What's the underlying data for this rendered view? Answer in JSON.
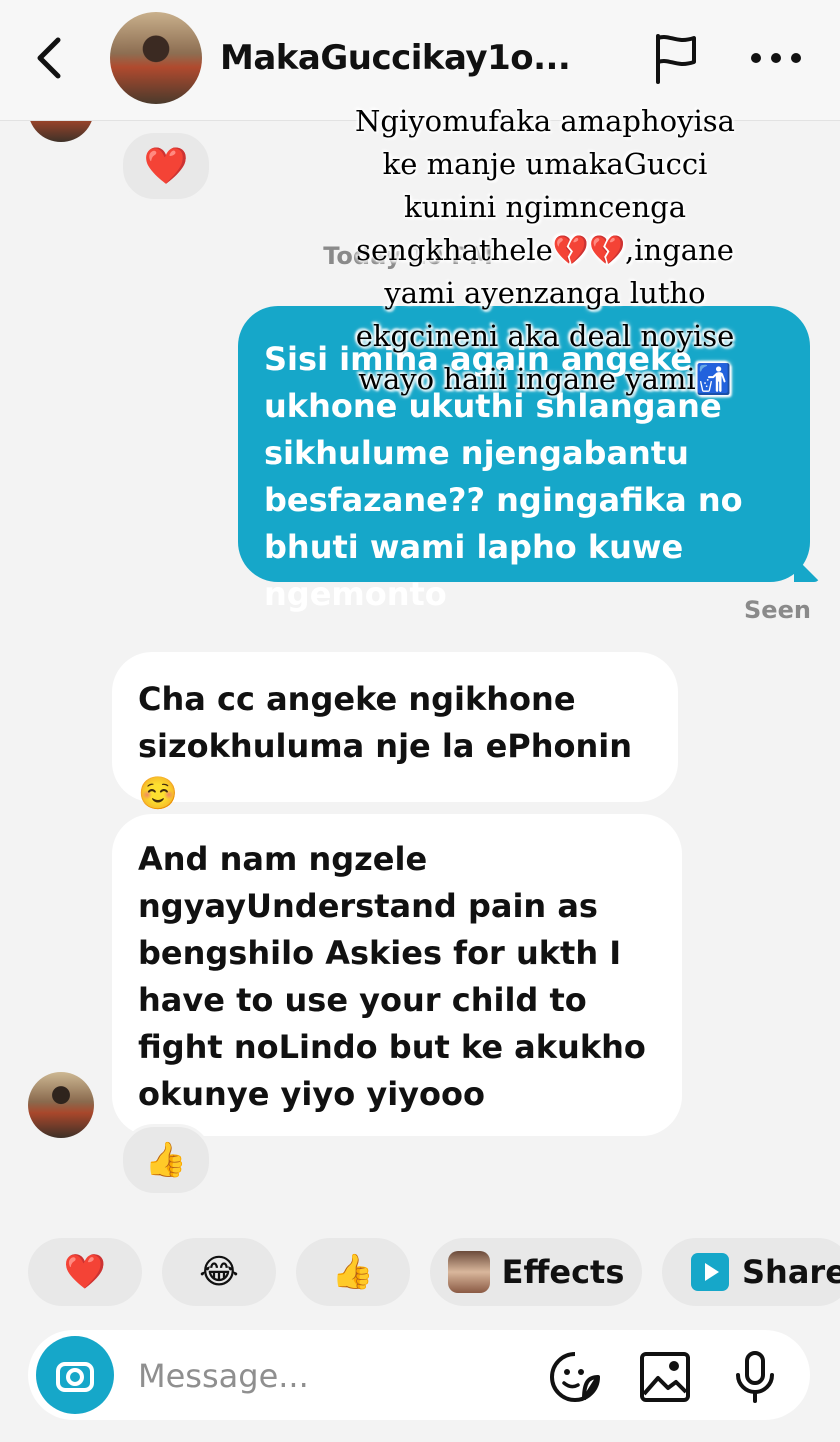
{
  "header": {
    "contact_name": "MakaGuccikay1o..."
  },
  "overlay_caption": "Ngiyomufaka amaphoyisa ke manje umakaGucci kunini ngimncenga sengkhathele💔💔,ingane yami ayenzanga lutho ekgcineni aka deal noyise wayo haiii ingane yami🚮",
  "top_reaction": "❤️",
  "timestamp": "Today 10 PM",
  "outgoing_message": {
    "text": "Sisi imina again angeke ukhone ukuthi shlangane sikhulume njengabantu besfazane?? ngingafika no bhuti wami lapho kuwe ngemonto",
    "status": "Seen"
  },
  "incoming_messages": [
    {
      "text": "Cha cc angeke ngikhone sizokhuluma nje la ePhonin ☺️"
    },
    {
      "text": "And nam ngzele ngyayUnderstand pain as bengshilo Askies for ukth I have to use your child to fight noLindo but ke akukho okunye yiyo yiyooo",
      "reaction": "👍"
    }
  ],
  "quick_reactions": {
    "heart": "❤️",
    "laugh": "😂",
    "thumbs": "👍",
    "effects_label": "Effects",
    "share_label": "Share"
  },
  "composer": {
    "placeholder": "Message..."
  },
  "colors": {
    "accent": "#16a7c9",
    "background": "#f3f3f3"
  }
}
